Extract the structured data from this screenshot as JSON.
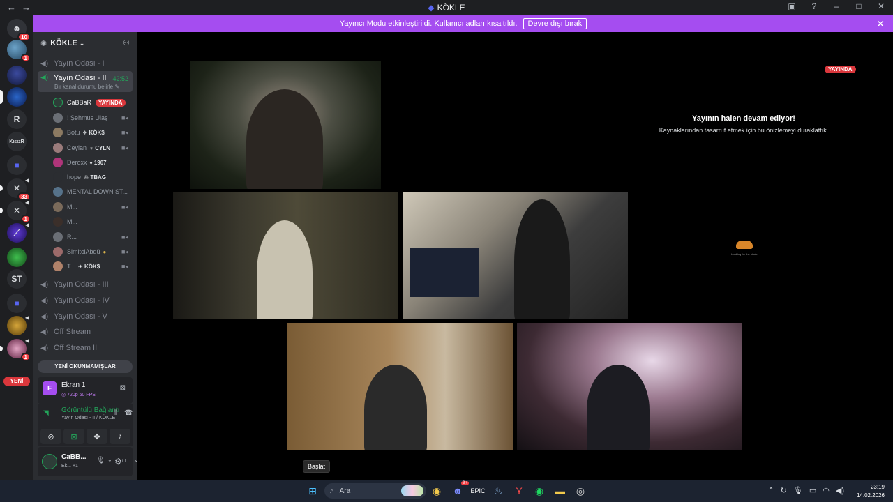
{
  "window": {
    "title": "KÖKLE",
    "back_icon": "arrow-left-icon",
    "forward_icon": "arrow-right-icon"
  },
  "banner": {
    "message": "Yayıncı Modu etkinleştirildi. Kullanıcı adları kısaltıldı.",
    "button": "Devre dışı bırak"
  },
  "rail": {
    "items": [
      {
        "label": "",
        "badge": "10"
      },
      {
        "label": "",
        "badge": "1"
      },
      {
        "label": "",
        "badge": ""
      },
      {
        "label": "",
        "badge": ""
      },
      {
        "label": "R",
        "badge": ""
      },
      {
        "label": "KısızR",
        "badge": ""
      },
      {
        "label": "",
        "badge": ""
      },
      {
        "label": "",
        "badge": "33"
      },
      {
        "label": "",
        "badge": "1"
      },
      {
        "label": "",
        "badge": ""
      },
      {
        "label": "",
        "badge": ""
      },
      {
        "label": "ST",
        "badge": ""
      },
      {
        "label": "",
        "badge": ""
      },
      {
        "label": "",
        "badge": ""
      },
      {
        "label": "",
        "badge": "1"
      }
    ],
    "new_label": "YENİ"
  },
  "guild": {
    "name": "KÖKLE",
    "channels_top": [
      "Yayın Odası - I"
    ],
    "active_channel": {
      "name": "Yayın Odası - II",
      "timer": "42:52",
      "status": "Bir kanal durumu belirle"
    },
    "members": [
      {
        "name": "CaBBaR",
        "tag": "",
        "live": "YAYINDA",
        "cam": false
      },
      {
        "name": "! Şehmus Ulaş",
        "tag": "",
        "live": "",
        "cam": true
      },
      {
        "name": "Botu",
        "tag": "KÖK$",
        "live": "",
        "cam": true
      },
      {
        "name": "Ceylan",
        "tag": "CYLN",
        "live": "",
        "cam": true
      },
      {
        "name": "Deroxx",
        "tag": "1907",
        "live": "",
        "cam": false
      },
      {
        "name": "hope",
        "tag": "TBAG",
        "live": "",
        "cam": false
      },
      {
        "name": "MENTAL DOWN ST...",
        "tag": "",
        "live": "",
        "cam": false
      },
      {
        "name": "M...",
        "tag": "",
        "live": "",
        "cam": true
      },
      {
        "name": "M...",
        "tag": "",
        "live": "",
        "cam": false
      },
      {
        "name": "R...",
        "tag": "",
        "live": "",
        "cam": true
      },
      {
        "name": "SimitciAbdü",
        "tag": "",
        "live": "",
        "cam": true
      },
      {
        "name": "T...",
        "tag": "KÖK$",
        "live": "",
        "cam": true
      }
    ],
    "channels_bottom": [
      "Yayın Odası - III",
      "Yayın Odası - IV",
      "Yayın Odası - V",
      "Off Stream",
      "Off Stream II"
    ],
    "unread_label": "YENİ OKUNMAMIŞLAR"
  },
  "screen_share": {
    "initial": "F",
    "title": "Ekran 1",
    "quality": "720p 60 FPS"
  },
  "voice": {
    "status": "Görüntülü Bağlantı",
    "location": "Yayın Odası - II / KÖKLE"
  },
  "user": {
    "name": "CaBB...",
    "status": "Ek...",
    "extra": "+1"
  },
  "stage": {
    "live_badge": "YAYINDA",
    "paused_title": "Yayının halen devam ediyor!",
    "paused_sub": "Kaynaklarından tasarruf etmek için bu önizlemeyi duraklattık.",
    "loading_text": "Looking for the pirate"
  },
  "tooltip": "Başlat",
  "taskbar": {
    "search_placeholder": "Ara",
    "time": "23:19",
    "date": "14.02.2026",
    "discord_badge": "9+"
  }
}
